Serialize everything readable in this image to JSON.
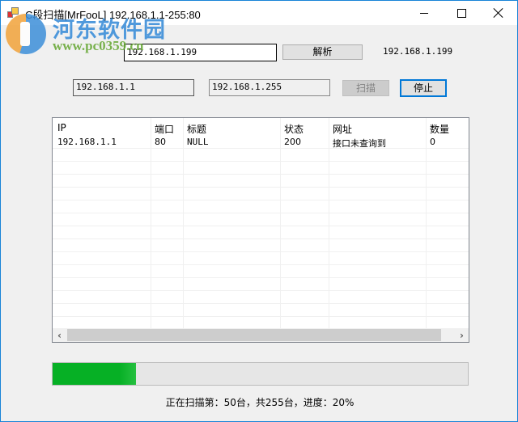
{
  "window": {
    "title": "C段扫描[MrFooL] 192.168.1.1-255:80",
    "icon": "app-icon",
    "controls": [
      "minimize-icon",
      "maximize-icon",
      "close-icon"
    ]
  },
  "watermark": {
    "text_cn": "河东软件园",
    "url": "www.pc0359.cn"
  },
  "resolve": {
    "host_value": "192.168.1.199",
    "button_label": "解析",
    "result_ip": "192.168.1.199"
  },
  "range": {
    "start_ip": "192.168.1.1",
    "end_ip": "192.168.1.255",
    "scan_label": "扫描",
    "scan_enabled": false,
    "stop_label": "停止"
  },
  "list": {
    "columns": [
      "IP",
      "端口",
      "标题",
      "状态",
      "网址",
      "数量"
    ],
    "rows": [
      [
        "192.168.1.1",
        "80",
        "NULL",
        "200",
        "接口未查询到",
        "0"
      ]
    ],
    "scroll_left_icon": "chevron-left-icon",
    "scroll_right_icon": "chevron-right-icon"
  },
  "progress": {
    "percent": 20,
    "fill_color": "#06b025",
    "status_text": "正在扫描第：50台，共255台，进度：20%"
  },
  "colors": {
    "window_border": "#1883d7",
    "focus_border": "#0078d7"
  }
}
